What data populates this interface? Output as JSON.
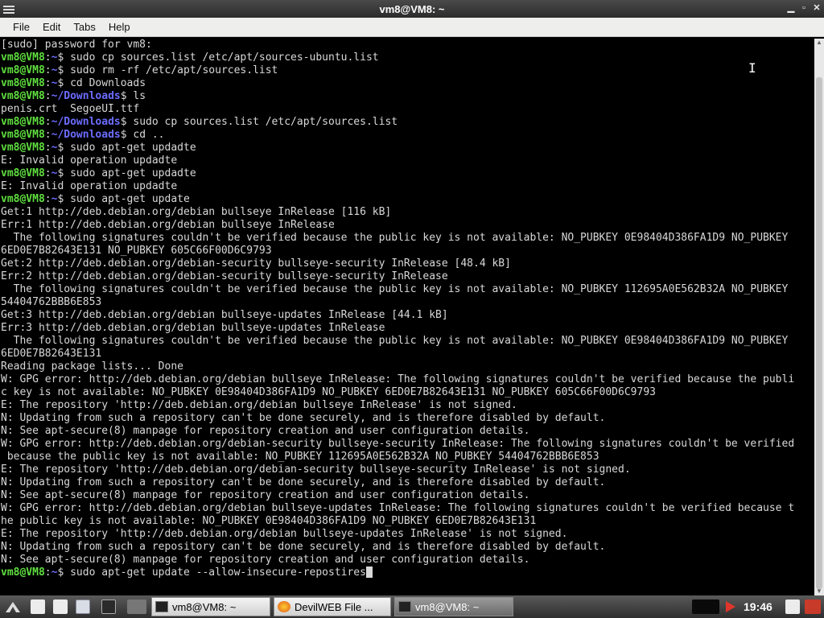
{
  "window": {
    "title": "vm8@VM8: ~"
  },
  "menu": [
    "File",
    "Edit",
    "Tabs",
    "Help"
  ],
  "terminal": {
    "user_prompt": "vm8@VM8",
    "lines": [
      {
        "t": "out",
        "text": "[sudo] password for vm8:"
      },
      {
        "t": "cmd",
        "path": "~",
        "cmd": " sudo cp sources.list /etc/apt/sources-ubuntu.list"
      },
      {
        "t": "cmd",
        "path": "~",
        "cmd": " sudo rm -rf /etc/apt/sources.list"
      },
      {
        "t": "cmd",
        "path": "~",
        "cmd": " cd Downloads"
      },
      {
        "t": "cmd",
        "path": "~/Downloads",
        "cmd": " ls"
      },
      {
        "t": "out",
        "text": "penis.crt  SegoeUI.ttf"
      },
      {
        "t": "cmd",
        "path": "~/Downloads",
        "cmd": " sudo cp sources.list /etc/apt/sources.list"
      },
      {
        "t": "cmd",
        "path": "~/Downloads",
        "cmd": " cd .."
      },
      {
        "t": "cmd",
        "path": "~",
        "cmd": " sudo apt-get updadte"
      },
      {
        "t": "out",
        "text": "E: Invalid operation updadte"
      },
      {
        "t": "cmd",
        "path": "~",
        "cmd": " sudo apt-get updadte"
      },
      {
        "t": "out",
        "text": "E: Invalid operation updadte"
      },
      {
        "t": "cmd",
        "path": "~",
        "cmd": " sudo apt-get update"
      },
      {
        "t": "out",
        "text": "Get:1 http://deb.debian.org/debian bullseye InRelease [116 kB]"
      },
      {
        "t": "out",
        "text": "Err:1 http://deb.debian.org/debian bullseye InRelease"
      },
      {
        "t": "out",
        "text": "  The following signatures couldn't be verified because the public key is not available: NO_PUBKEY 0E98404D386FA1D9 NO_PUBKEY"
      },
      {
        "t": "out",
        "text": "6ED0E7B82643E131 NO_PUBKEY 605C66F00D6C9793"
      },
      {
        "t": "out",
        "text": "Get:2 http://deb.debian.org/debian-security bullseye-security InRelease [48.4 kB]"
      },
      {
        "t": "out",
        "text": "Err:2 http://deb.debian.org/debian-security bullseye-security InRelease"
      },
      {
        "t": "out",
        "text": "  The following signatures couldn't be verified because the public key is not available: NO_PUBKEY 112695A0E562B32A NO_PUBKEY"
      },
      {
        "t": "out",
        "text": "54404762BBB6E853"
      },
      {
        "t": "out",
        "text": "Get:3 http://deb.debian.org/debian bullseye-updates InRelease [44.1 kB]"
      },
      {
        "t": "out",
        "text": "Err:3 http://deb.debian.org/debian bullseye-updates InRelease"
      },
      {
        "t": "out",
        "text": "  The following signatures couldn't be verified because the public key is not available: NO_PUBKEY 0E98404D386FA1D9 NO_PUBKEY"
      },
      {
        "t": "out",
        "text": "6ED0E7B82643E131"
      },
      {
        "t": "out",
        "text": "Reading package lists... Done"
      },
      {
        "t": "out",
        "text": "W: GPG error: http://deb.debian.org/debian bullseye InRelease: The following signatures couldn't be verified because the publi"
      },
      {
        "t": "out",
        "text": "c key is not available: NO_PUBKEY 0E98404D386FA1D9 NO_PUBKEY 6ED0E7B82643E131 NO_PUBKEY 605C66F00D6C9793"
      },
      {
        "t": "out",
        "text": "E: The repository 'http://deb.debian.org/debian bullseye InRelease' is not signed."
      },
      {
        "t": "out",
        "text": "N: Updating from such a repository can't be done securely, and is therefore disabled by default."
      },
      {
        "t": "out",
        "text": "N: See apt-secure(8) manpage for repository creation and user configuration details."
      },
      {
        "t": "out",
        "text": "W: GPG error: http://deb.debian.org/debian-security bullseye-security InRelease: The following signatures couldn't be verified"
      },
      {
        "t": "out",
        "text": " because the public key is not available: NO_PUBKEY 112695A0E562B32A NO_PUBKEY 54404762BBB6E853"
      },
      {
        "t": "out",
        "text": "E: The repository 'http://deb.debian.org/debian-security bullseye-security InRelease' is not signed."
      },
      {
        "t": "out",
        "text": "N: Updating from such a repository can't be done securely, and is therefore disabled by default."
      },
      {
        "t": "out",
        "text": "N: See apt-secure(8) manpage for repository creation and user configuration details."
      },
      {
        "t": "out",
        "text": "W: GPG error: http://deb.debian.org/debian bullseye-updates InRelease: The following signatures couldn't be verified because t"
      },
      {
        "t": "out",
        "text": "he public key is not available: NO_PUBKEY 0E98404D386FA1D9 NO_PUBKEY 6ED0E7B82643E131"
      },
      {
        "t": "out",
        "text": "E: The repository 'http://deb.debian.org/debian bullseye-updates InRelease' is not signed."
      },
      {
        "t": "out",
        "text": "N: Updating from such a repository can't be done securely, and is therefore disabled by default."
      },
      {
        "t": "out",
        "text": "N: See apt-secure(8) manpage for repository creation and user configuration details."
      },
      {
        "t": "cmd",
        "path": "~",
        "cmd": " sudo apt-get update --allow-insecure-repostires",
        "cursor": true
      }
    ]
  },
  "taskbar": {
    "tasks": [
      {
        "label": "vm8@VM8: ~",
        "icon": "terminal-icon",
        "active": false
      },
      {
        "label": "DevilWEB File ...",
        "icon": "firefox-icon",
        "active": false
      },
      {
        "label": "vm8@VM8: ~",
        "icon": "terminal-icon",
        "active": true
      }
    ],
    "clock": "19:46"
  },
  "colors": {
    "prompt_user": "#5fdf3f",
    "prompt_path": "#6c6cff",
    "text": "#d8d8d8",
    "background": "#000000"
  }
}
